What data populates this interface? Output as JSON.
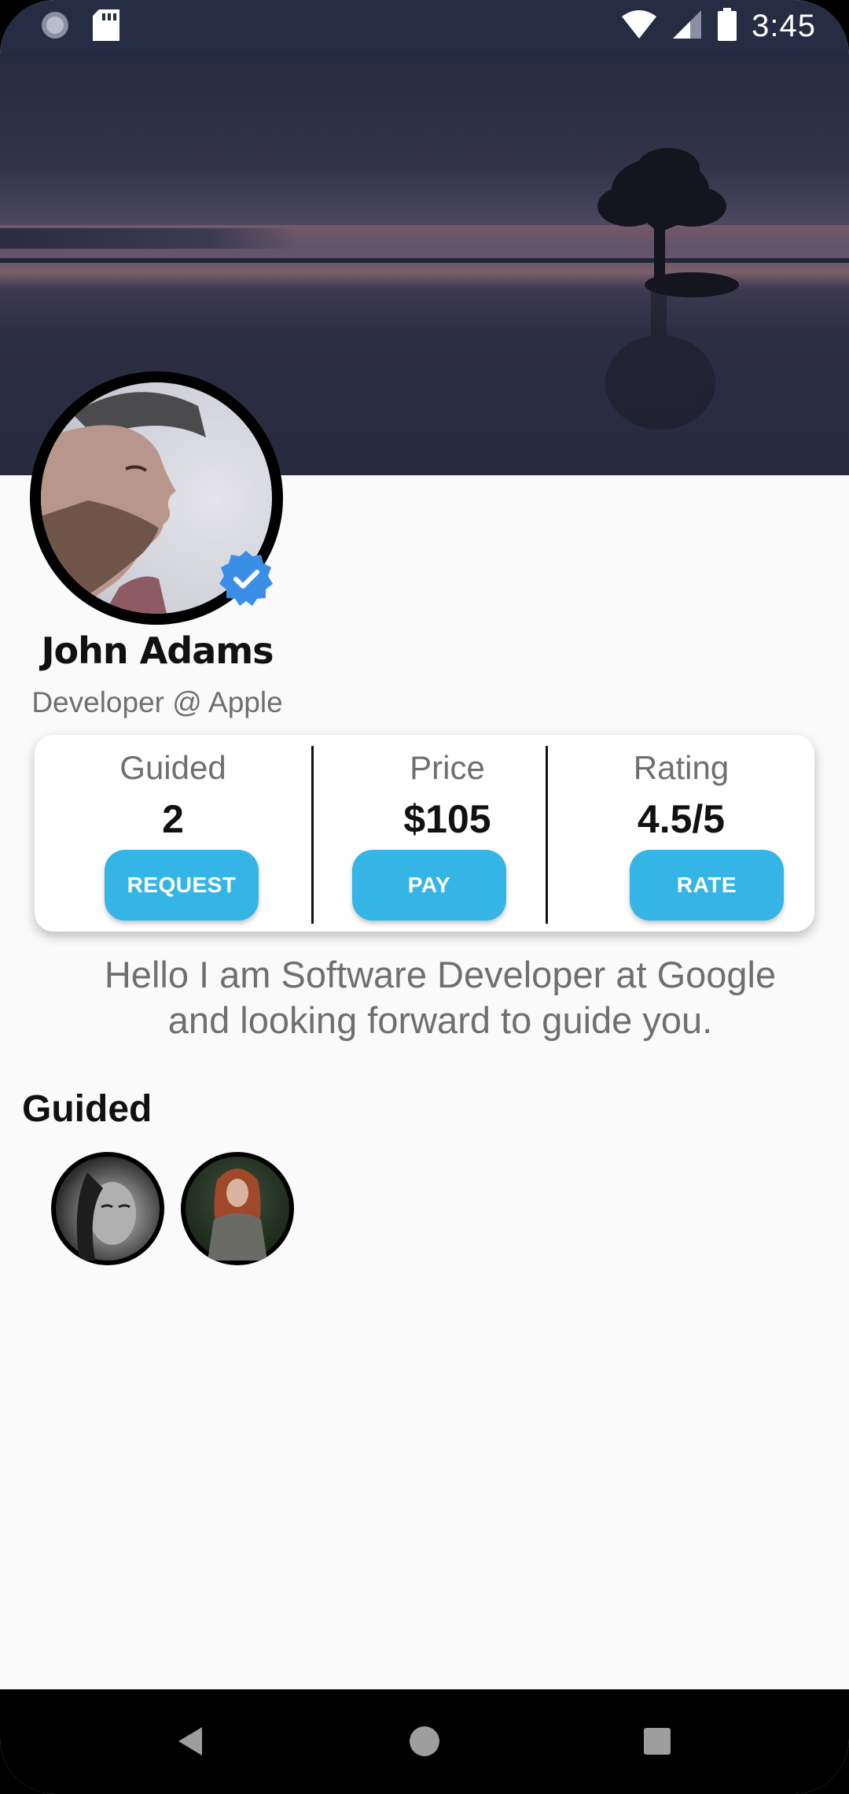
{
  "status_bar": {
    "time": "3:45",
    "icons": [
      "sync-icon",
      "sd-card-icon",
      "wifi-icon",
      "signal-icon",
      "battery-icon"
    ]
  },
  "profile": {
    "name": "John Adams",
    "subtitle": "Developer @ Apple",
    "verified_icon": "verified-badge-icon"
  },
  "stats": [
    {
      "label": "Guided",
      "value": "2",
      "button": "REQUEST"
    },
    {
      "label": "Price",
      "value": "$105",
      "button": "PAY"
    },
    {
      "label": "Rating",
      "value": "4.5/5",
      "button": "RATE"
    }
  ],
  "bio": "Hello I am Software Developer at Google and looking forward to guide you.",
  "guided_section": {
    "title": "Guided"
  },
  "nav_bar": {
    "icons": [
      "back-icon",
      "home-icon",
      "recents-icon"
    ]
  },
  "colors": {
    "accent": "#35b4e6",
    "status_bar": "#252c43",
    "verified": "#3a8ee6"
  }
}
